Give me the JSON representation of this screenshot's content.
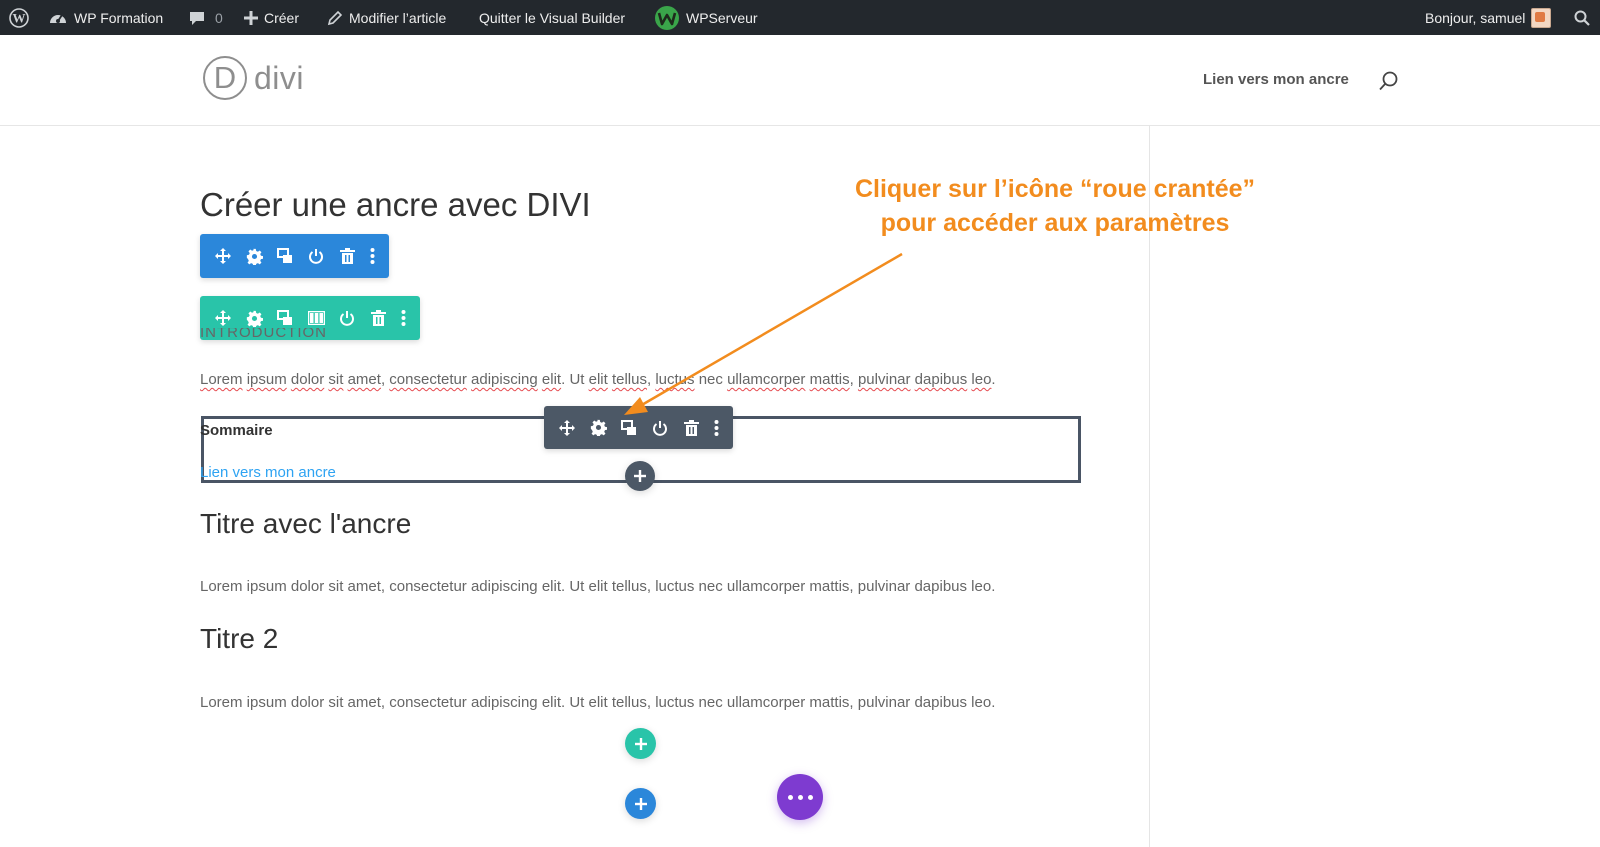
{
  "admin_bar": {
    "site_name": "WP Formation",
    "comments_count": "0",
    "create_label": "Créer",
    "edit_post_label": "Modifier l’article",
    "exit_builder_label": "Quitter le Visual Builder",
    "host_label": "WPServeur",
    "greeting": "Bonjour, samuel"
  },
  "site_header": {
    "logo_letter": "D",
    "logo_text": "divi",
    "nav_link": "Lien vers mon ancre"
  },
  "content": {
    "page_title": "Créer une ancre avec DIVI",
    "intro_label": "INTRODUCTION",
    "paragraph_words_1": [
      "Lorem",
      "ipsum",
      "dolor",
      "sit",
      "amet",
      "consectetur",
      "adipiscing",
      "elit",
      "Ut",
      "elit",
      "tellus",
      "luctus",
      "nec",
      "ullamcorper",
      "mattis",
      "pulvinar",
      "dapibus",
      "leo"
    ],
    "paragraph_1": "Lorem ipsum dolor sit amet, consectetur adipiscing elit. Ut elit tellus, luctus nec ullamcorper mattis, pulvinar dapibus leo.",
    "summary_title": "Sommaire",
    "summary_link": "Lien vers mon ancre",
    "heading_2": "Titre avec l'ancre",
    "paragraph_2": "Lorem ipsum dolor sit amet, consectetur adipiscing elit. Ut elit tellus, luctus nec ullamcorper mattis, pulvinar dapibus leo.",
    "heading_3": "Titre 2",
    "paragraph_3": "Lorem ipsum dolor sit amet, consectetur adipiscing elit. Ut elit tellus, luctus nec ullamcorper mattis, pulvinar dapibus leo."
  },
  "annotation": {
    "line_1": "Cliquer sur l’icône “roue crantée”",
    "line_2": "pour accéder aux paramètres"
  },
  "colors": {
    "admin_bar": "#23282d",
    "section_toolbar": "#2b87da",
    "row_toolbar": "#29c4a9",
    "module_toolbar": "#4c5866",
    "fab": "#7e3bd0",
    "annotation": "#f28c1e",
    "link": "#2ea3f2"
  },
  "icons": {
    "section_toolbar": [
      "move-icon",
      "gear-icon",
      "duplicate-icon",
      "power-icon",
      "trash-icon",
      "more-icon"
    ],
    "row_toolbar": [
      "move-icon",
      "gear-icon",
      "duplicate-icon",
      "columns-icon",
      "power-icon",
      "trash-icon",
      "more-icon"
    ],
    "module_toolbar": [
      "move-icon",
      "gear-icon",
      "duplicate-icon",
      "power-icon",
      "trash-icon",
      "more-icon"
    ]
  }
}
